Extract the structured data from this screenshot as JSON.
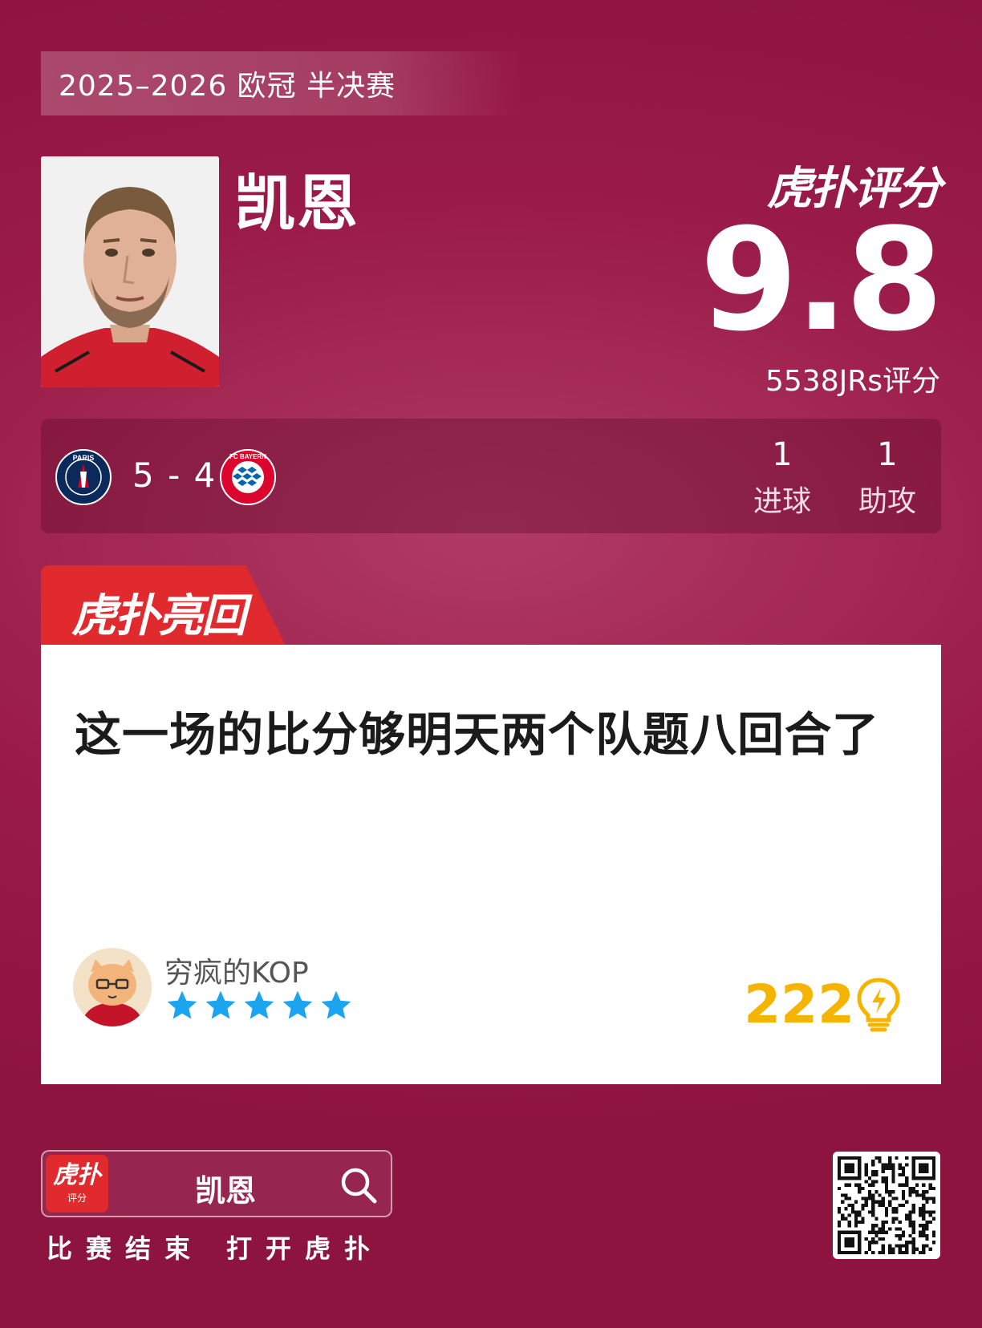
{
  "match": {
    "title": "2025–2026 欧冠 半决赛",
    "home_score": "5",
    "away_score": "4",
    "score_display": "5 - 4"
  },
  "player": {
    "name": "凯恩"
  },
  "rating": {
    "logo_text": "虎扑评分",
    "score": "9.8",
    "count_text": "5538JRs评分"
  },
  "teams": {
    "home": {
      "icon": "psg-crest-icon",
      "ring_text": "PARIS",
      "color": "#0b2a5b",
      "accent": "#d8001a"
    },
    "away": {
      "icon": "bayern-crest-icon",
      "ring_text": "FC BAYERN",
      "color": "#dc052d",
      "accent": "#0066b2"
    }
  },
  "stats": {
    "goals_value": "1",
    "goals_label": "进球",
    "assists_value": "1",
    "assists_label": "助攻"
  },
  "highlight": {
    "tab_label": "虎扑亮回复",
    "tab_color": "#e12a2e"
  },
  "comment": {
    "text": "这一场的比分够明天两个队题八回合了",
    "username": "穷疯的KOP",
    "stars": 5,
    "star_color": "#1ca4ee",
    "likes": "222",
    "like_icon": "lightbulb-icon",
    "like_color": "#f4b400"
  },
  "footer": {
    "app_icon_main": "虎扑",
    "app_icon_sub": "评分",
    "search_text": "凯恩",
    "left_caption": "比赛结束",
    "right_caption": "打开虎扑"
  },
  "colors": {
    "background": "#9a1b47",
    "card": "#ffffff"
  }
}
